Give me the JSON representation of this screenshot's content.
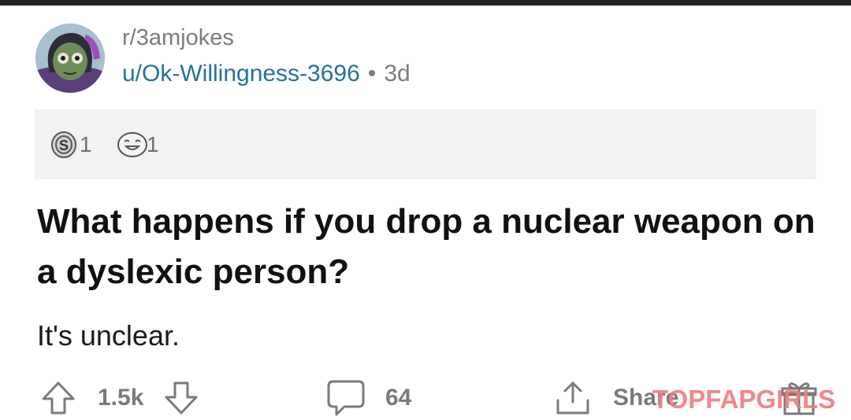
{
  "post": {
    "subreddit": "r/3amjokes",
    "username": "u/Ok-Willingness-3696",
    "separator": "•",
    "age": "3d",
    "awards": [
      {
        "icon": "silver-award-icon",
        "count": "1"
      },
      {
        "icon": "laughing-award-icon",
        "count": "1"
      }
    ],
    "title": "What happens if you drop a nuclear weapon on a dyslexic person?",
    "body": "It's unclear."
  },
  "actions": {
    "upvote_icon": "upvote-arrow-icon",
    "score": "1.5k",
    "downvote_icon": "downvote-arrow-icon",
    "comment_icon": "comment-bubble-icon",
    "comments": "64",
    "share_icon": "share-icon",
    "share_label": "Share",
    "gift_icon": "gift-icon"
  },
  "watermark": "TOPFAPGIRLS",
  "colors": {
    "username": "#24739b",
    "meta_gray": "#7c7c7c",
    "awards_bg": "#f2f2f2",
    "watermark": "#f07c7c"
  }
}
